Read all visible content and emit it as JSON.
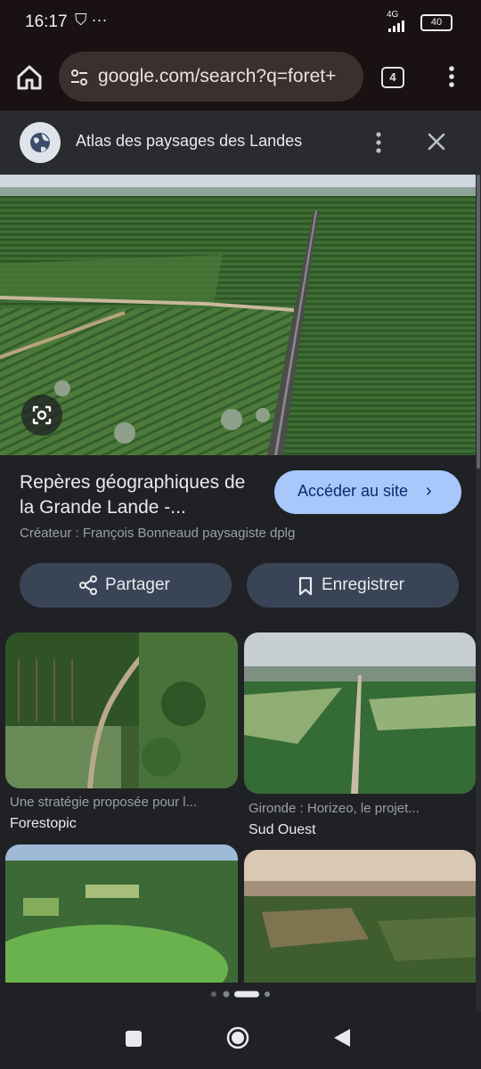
{
  "status_bar": {
    "time": "16:17",
    "misc": "⛉ ···",
    "network": "4G",
    "battery": "40"
  },
  "browser": {
    "url": "google.com/search?q=foret+",
    "tab_count": "4"
  },
  "sheet": {
    "title": "Atlas des paysages des Landes"
  },
  "result": {
    "title": "Repères géographiques de la Grande Lande -...",
    "visit_label": "Accéder au site",
    "visit_chevron": "›",
    "creator": "Créateur : François Bonneaud paysagiste dplg",
    "share_label": "Partager",
    "save_label": "Enregistrer"
  },
  "related": [
    {
      "caption": "Une stratégie proposée pour l...",
      "source": "Forestopic"
    },
    {
      "caption": "Gironde : Horizeo, le projet...",
      "source": "Sud Ouest"
    },
    {
      "caption": "",
      "source": ""
    },
    {
      "caption": "",
      "source": ""
    }
  ],
  "colors": {
    "accent": "#a8c7fa",
    "pill_bg": "#394457",
    "page_bg": "#202124"
  }
}
